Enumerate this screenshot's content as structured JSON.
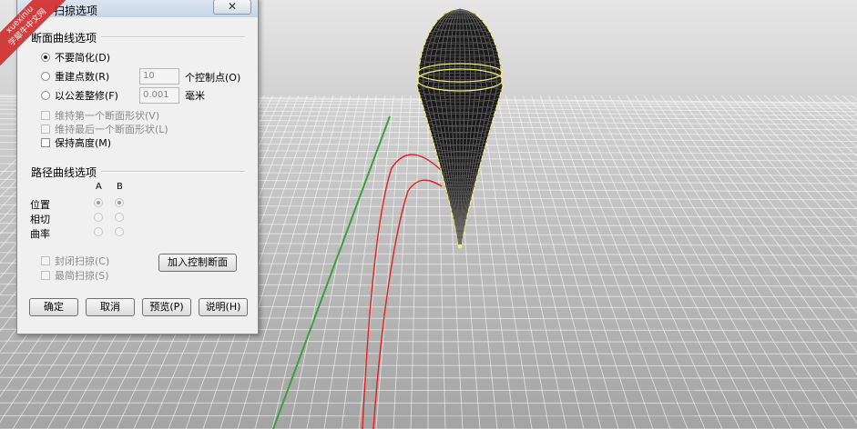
{
  "dialog": {
    "title": "扫掠选项",
    "close_glyph": "✕",
    "section_profile": {
      "title": "断面曲线选项",
      "options": [
        {
          "label": "不要简化(D)",
          "checked": true
        },
        {
          "label": "重建点数(R)",
          "checked": false
        },
        {
          "label": "以公差整修(F)",
          "checked": false
        }
      ],
      "rebuild_value": "10",
      "rebuild_unit": "个控制点(O)",
      "tolerance_value": "0.001",
      "tolerance_unit": "毫米",
      "checkboxes": [
        {
          "label": "维持第一个断面形状(V)",
          "enabled": false
        },
        {
          "label": "维持最后一个断面形状(L)",
          "enabled": false
        },
        {
          "label": "保持高度(M)",
          "enabled": true
        }
      ]
    },
    "section_rail": {
      "title": "路径曲线选项",
      "col_a": "A",
      "col_b": "B",
      "rows": [
        {
          "label": "位置"
        },
        {
          "label": "相切"
        },
        {
          "label": "曲率"
        }
      ],
      "closed_sweep": "封闭扫掠(C)",
      "simple_sweep": "最简扫掠(S)",
      "add_slash_button": "加入控制断面"
    },
    "buttons": {
      "ok": "确定",
      "cancel": "取消",
      "preview": "预览(P)",
      "help": "说明(H)"
    }
  },
  "watermark": {
    "line1": "xuexiniu",
    "line2": "学犀牛中文网"
  },
  "colors": {
    "viewport_bg": "#bdbdbd",
    "grid": "#ffffff",
    "curve": "#e0201e",
    "highlight": "#f2f07a",
    "axis_green": "#3f9d3f"
  }
}
